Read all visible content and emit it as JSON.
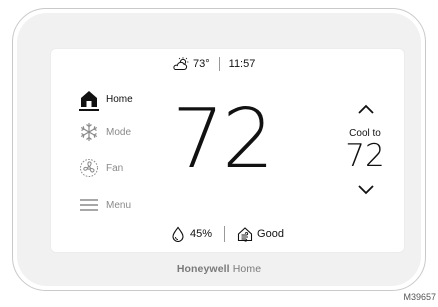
{
  "status": {
    "outdoor_temp": "73°",
    "time": "11:57",
    "humidity": "45%",
    "air_quality": "Good"
  },
  "menu": {
    "items": [
      {
        "label": "Home",
        "icon": "home-icon",
        "active": true
      },
      {
        "label": "Mode",
        "icon": "snowflake-icon",
        "active": false
      },
      {
        "label": "Fan",
        "icon": "fan-icon",
        "active": false
      },
      {
        "label": "Menu",
        "icon": "hamburger-icon",
        "active": false
      }
    ]
  },
  "temperature": {
    "current": "72",
    "setpoint_label": "Cool to",
    "setpoint": "72"
  },
  "brand": {
    "name_bold": "Honeywell",
    "name_light": "Home"
  },
  "figure_code": "M39657",
  "colors": {
    "text": "#111111",
    "inactive": "#8a8a8a",
    "bezel": "#f1f1f1",
    "screen": "#ffffff"
  }
}
